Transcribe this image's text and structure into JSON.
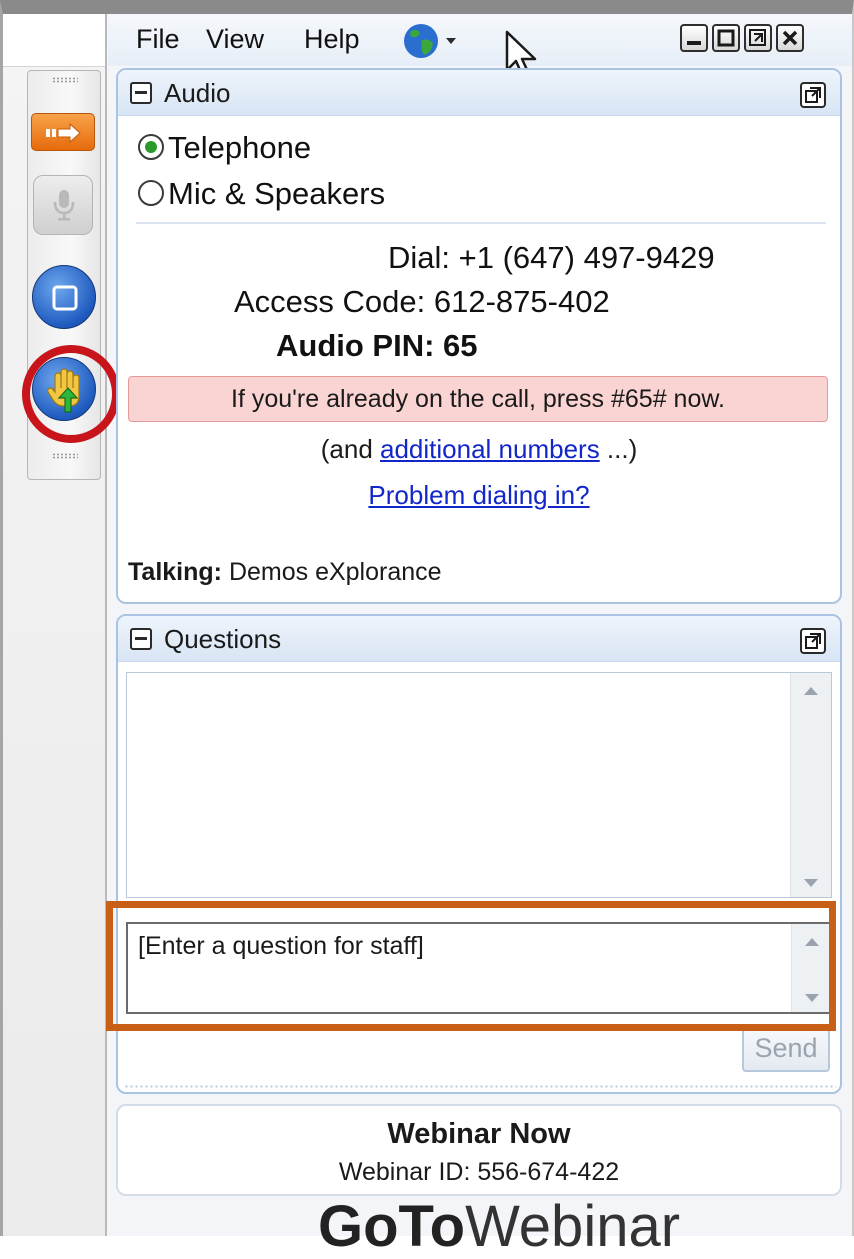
{
  "menubar": {
    "items": [
      "File",
      "View",
      "Help"
    ]
  },
  "audio": {
    "title": "Audio",
    "options": [
      {
        "label": "Telephone",
        "selected": true
      },
      {
        "label": "Mic & Speakers",
        "selected": false
      }
    ],
    "dial_label": "Dial:",
    "dial_value": "+1 (647) 497-9429",
    "access_label": "Access Code:",
    "access_value": "612-875-402",
    "pin_label": "Audio PIN:",
    "pin_value": "65",
    "alert": "If you're already on the call, press #65# now.",
    "additional_prefix": "(and ",
    "additional_link": "additional numbers",
    "additional_suffix": " ...)",
    "problem_link": "Problem dialing in?",
    "talking_label": "Talking:",
    "talking_value": "Demos eXplorance"
  },
  "questions": {
    "title": "Questions",
    "input_placeholder": "[Enter a question for staff]",
    "send_label": "Send"
  },
  "webinar": {
    "title": "Webinar Now",
    "id_label": "Webinar ID: 556-674-422"
  },
  "brand": {
    "bold": "GoTo",
    "light": "Webinar"
  },
  "colors": {
    "highlight_circle": "#c8141b",
    "highlight_box": "#c75f16",
    "alert_bg": "#fad3d3",
    "link": "#1226c9"
  }
}
